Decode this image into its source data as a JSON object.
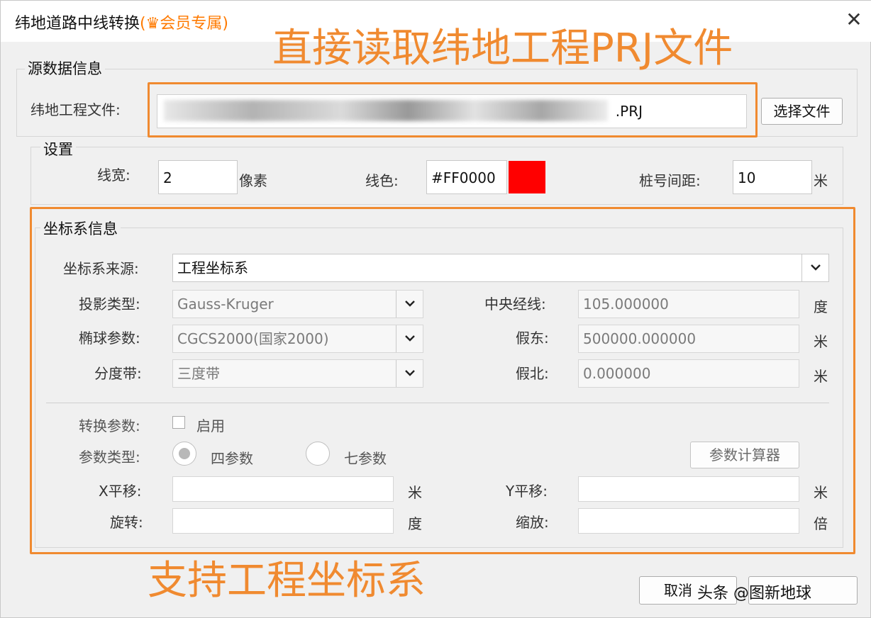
{
  "window": {
    "title": "纬地道路中线转换",
    "vip_label": "(♛会员专属)",
    "close_label": "✕"
  },
  "source": {
    "group_label": "源数据信息",
    "file_label": "纬地工程文件:",
    "file_value": ".PRJ",
    "choose_button": "选择文件"
  },
  "settings": {
    "group_label": "设置",
    "line_width_label": "线宽:",
    "line_width_value": "2",
    "line_width_unit": "像素",
    "line_color_label": "线色:",
    "line_color_value": "#FF0000",
    "line_color_swatch": "#ff0000",
    "station_spacing_label": "桩号间距:",
    "station_spacing_value": "10",
    "station_spacing_unit": "米"
  },
  "coord": {
    "group_label": "坐标系信息",
    "source_label": "坐标系来源:",
    "source_value": "工程坐标系",
    "projection_label": "投影类型:",
    "projection_value": "Gauss-Kruger",
    "ellipsoid_label": "椭球参数:",
    "ellipsoid_value": "CGCS2000(国家2000)",
    "zone_label": "分度带:",
    "zone_value": "三度带",
    "central_meridian_label": "中央经线:",
    "central_meridian_value": "105.000000",
    "central_meridian_unit": "度",
    "false_east_label": "假东:",
    "false_east_value": "500000.000000",
    "false_east_unit": "米",
    "false_north_label": "假北:",
    "false_north_value": "0.000000",
    "false_north_unit": "米"
  },
  "transform": {
    "params_label": "转换参数:",
    "enable_label": "启用",
    "type_label": "参数类型:",
    "four_param": "四参数",
    "seven_param": "七参数",
    "calculator_button": "参数计算器",
    "x_shift_label": "X平移:",
    "x_shift_unit": "米",
    "y_shift_label": "Y平移:",
    "y_shift_unit": "米",
    "rotation_label": "旋转:",
    "rotation_unit": "度",
    "scale_label": "缩放:",
    "scale_unit": "倍"
  },
  "footer": {
    "cancel_button": "取消",
    "watermark": "头条 @图新地球"
  },
  "annotations": {
    "top_text": "直接读取纬地工程PRJ文件",
    "bottom_text": "支持工程坐标系",
    "color": "#f08a30"
  }
}
